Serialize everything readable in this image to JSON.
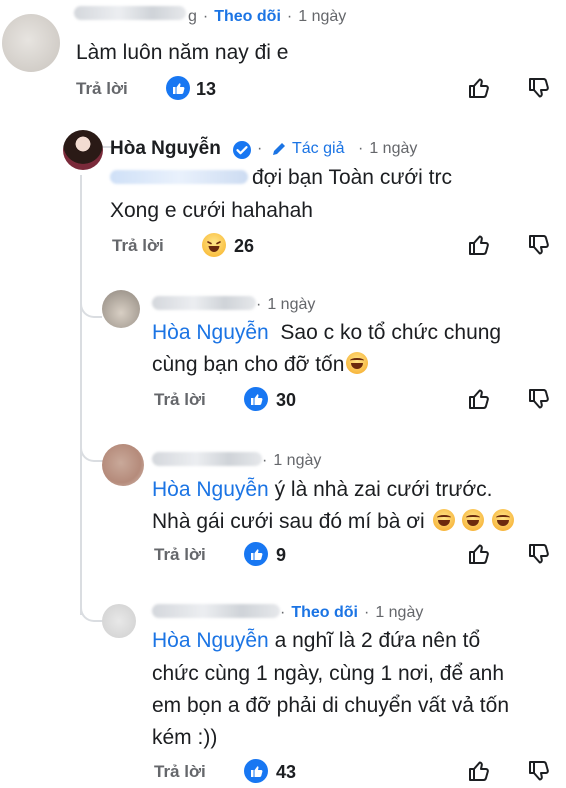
{
  "comments": [
    {
      "meta_suffix": "g",
      "follow": "Theo dõi",
      "dot": "·",
      "time": "1 ngày",
      "lines": [
        "Làm luôn năm nay đi e"
      ],
      "reply": "Trả lời",
      "count": "13"
    },
    {
      "author": "Hòa Nguyễn",
      "author_badge": "Tác giả",
      "dot": "·",
      "time": "1 ngày",
      "lines": [
        "đợi bạn Toàn cưới trc",
        "Xong e cưới hahahah"
      ],
      "reply": "Trả lời",
      "count": "26"
    },
    {
      "dot": "·",
      "time": "1 ngày",
      "mention": "Hòa Nguyễn",
      "lines": [
        "Sao c ko tổ chức chung",
        "cùng bạn cho đỡ tốn"
      ],
      "reply": "Trả lời",
      "count": "30"
    },
    {
      "dot": "·",
      "time": "1 ngày",
      "mention": "Hòa Nguyễn",
      "lines": [
        "ý là nhà zai cưới trước.",
        "Nhà gái cưới sau đó mí bà ơi"
      ],
      "reply": "Trả lời",
      "count": "9"
    },
    {
      "follow": "Theo dõi",
      "dot": "·",
      "time": "1 ngày",
      "mention": "Hòa Nguyễn",
      "lines": [
        "a nghĩ là 2 đứa nên tổ",
        "chức cùng 1 ngày, cùng 1 nơi, để anh",
        "em bọn a đỡ phải di chuyển vất vả tốn",
        "kém :))"
      ],
      "reply": "Trả lời",
      "count": "43"
    }
  ],
  "icons": {
    "like_reaction": "thumbs-up-icon",
    "haha_reaction": "laughing-face-icon",
    "like_action": "thumbs-up-outline-icon",
    "dislike_action": "thumbs-down-outline-icon",
    "verified": "verified-badge-icon",
    "author_badge": "pencil-icon"
  },
  "colors": {
    "link": "#1b74e4",
    "muted": "#65676b",
    "like_blue": "#1877f2"
  }
}
